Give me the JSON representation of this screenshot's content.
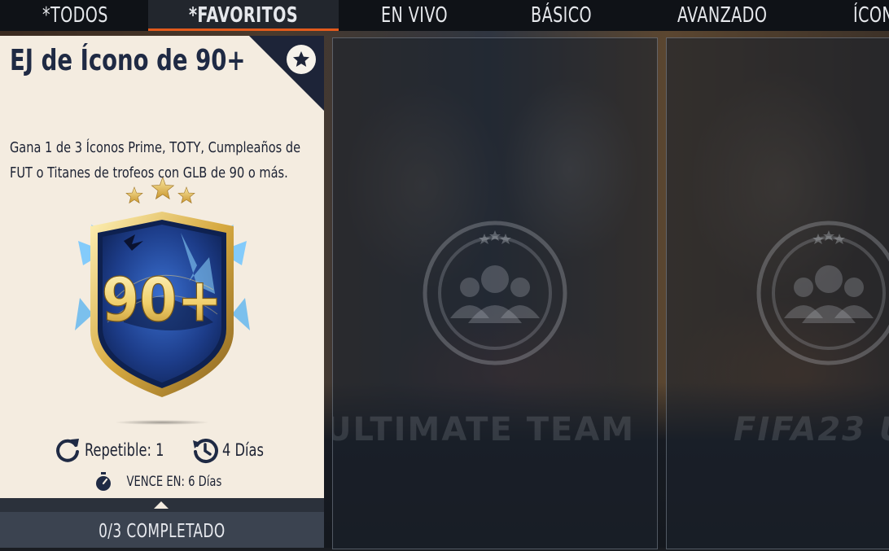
{
  "tabs": [
    {
      "label": "*TODOS"
    },
    {
      "label": "*FAVORITOS",
      "active": true
    },
    {
      "label": "EN VIVO"
    },
    {
      "label": "BÁSICO"
    },
    {
      "label": "AVANZADO"
    },
    {
      "label": "ÍCON"
    }
  ],
  "card": {
    "title": "EJ de Ícono de 90+",
    "description_line1": "Gana 1 de 3 Íconos Prime, TOTY, Cumpleaños de",
    "description_line2": "FUT o Titanes de trofeos con GLB de 90 o más.",
    "pack_label": "90+",
    "repeatable": "Repetible: 1",
    "refresh": "4 Días",
    "expires": "VENCE EN: 6 Días",
    "progress": "0/3 COMPLETADO"
  },
  "side_cards": [
    {
      "watermark": "ULTIMATE TEAM"
    },
    {
      "watermark": "FIFA23 U"
    }
  ],
  "colors": {
    "accent": "#e25a1c",
    "card_bg": "#f4ece0",
    "navy": "#1d2438"
  }
}
